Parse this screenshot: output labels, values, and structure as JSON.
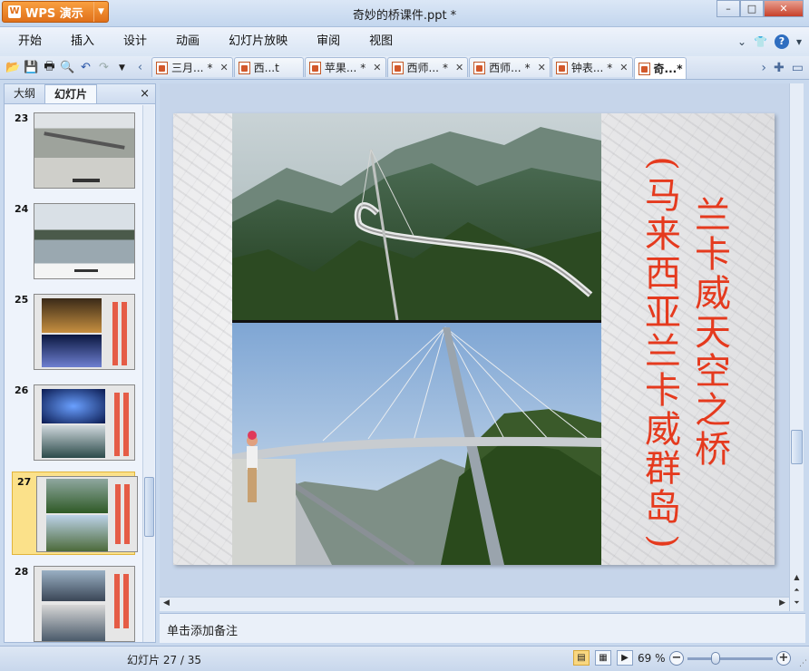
{
  "window": {
    "app_name": "WPS 演示",
    "title": "奇妙的桥课件.ppt *",
    "minimize": "–",
    "maximize": "□",
    "close": "✕"
  },
  "menu": [
    "开始",
    "插入",
    "设计",
    "动画",
    "幻灯片放映",
    "审阅",
    "视图"
  ],
  "tabs": [
    {
      "label": "三月...",
      "x": "*"
    },
    {
      "label": "西...t",
      "x": ""
    },
    {
      "label": "苹果...",
      "x": "*"
    },
    {
      "label": "西师...",
      "x": "*"
    },
    {
      "label": "西师...",
      "x": "*"
    },
    {
      "label": "钟表...",
      "x": "*"
    },
    {
      "label": "奇...*",
      "x": ""
    }
  ],
  "left_panel": {
    "tab_outline": "大纲",
    "tab_slides": "幻灯片",
    "close": "×",
    "slides": [
      "23",
      "24",
      "25",
      "26",
      "27",
      "28"
    ],
    "selected": "27"
  },
  "slide": {
    "title": "兰卡威天空之桥",
    "subtitle": "(马来西亚兰卡威群岛)",
    "subtitle_body": "马来西亚兰卡威群岛"
  },
  "notes_placeholder": "单击添加备注",
  "status": {
    "slide_count": "幻灯片 27 / 35",
    "zoom": "69 %",
    "zoom_level": 0.38
  },
  "colors": {
    "accent_orange": "#e0701a",
    "slide_text_red": "#e53a1e",
    "selection_yellow": "#fbe18a"
  }
}
